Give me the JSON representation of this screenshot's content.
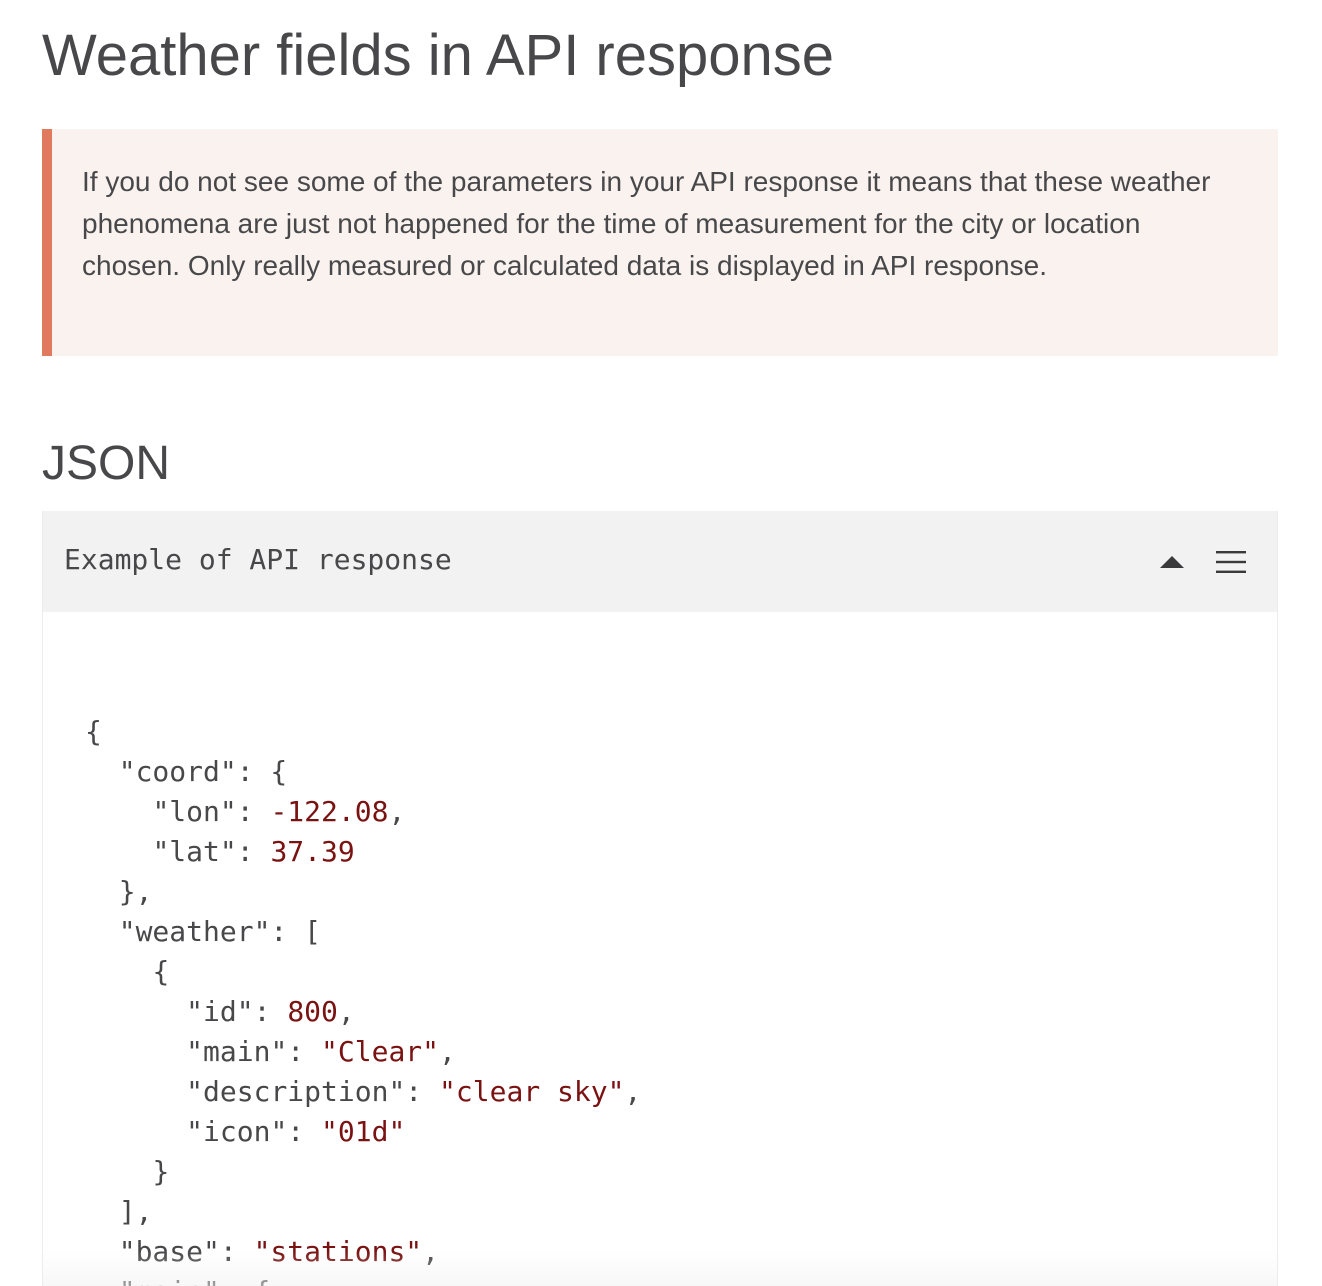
{
  "page": {
    "title": "Weather fields in API response"
  },
  "alert": {
    "text": "If you do not see some of the parameters in your API response it means that these weather phenomena are just not happened for the time of measurement for the city or location chosen. Only really measured or calculated data is displayed in API response.",
    "accent_color": "#e07a5f",
    "background_color": "#f9f2ee"
  },
  "section": {
    "title": "JSON"
  },
  "code_panel": {
    "title": "Example of API response",
    "collapse_icon": "triangle-up-icon",
    "menu_icon": "hamburger-menu-icon",
    "value_color": "#7a1212",
    "lines": [
      {
        "indent": "",
        "parts": [
          {
            "t": "p",
            "v": "{"
          }
        ]
      },
      {
        "indent": "  ",
        "parts": [
          {
            "t": "p",
            "v": "\"coord\": {"
          }
        ]
      },
      {
        "indent": "    ",
        "parts": [
          {
            "t": "p",
            "v": "\"lon\": "
          },
          {
            "t": "v",
            "v": "-122.08"
          },
          {
            "t": "p",
            "v": ","
          }
        ]
      },
      {
        "indent": "    ",
        "parts": [
          {
            "t": "p",
            "v": "\"lat\": "
          },
          {
            "t": "v",
            "v": "37.39"
          }
        ]
      },
      {
        "indent": "  ",
        "parts": [
          {
            "t": "p",
            "v": "},"
          }
        ]
      },
      {
        "indent": "  ",
        "parts": [
          {
            "t": "p",
            "v": "\"weather\": ["
          }
        ]
      },
      {
        "indent": "    ",
        "parts": [
          {
            "t": "p",
            "v": "{"
          }
        ]
      },
      {
        "indent": "      ",
        "parts": [
          {
            "t": "p",
            "v": "\"id\": "
          },
          {
            "t": "v",
            "v": "800"
          },
          {
            "t": "p",
            "v": ","
          }
        ]
      },
      {
        "indent": "      ",
        "parts": [
          {
            "t": "p",
            "v": "\"main\": "
          },
          {
            "t": "v",
            "v": "\"Clear\""
          },
          {
            "t": "p",
            "v": ","
          }
        ]
      },
      {
        "indent": "      ",
        "parts": [
          {
            "t": "p",
            "v": "\"description\": "
          },
          {
            "t": "v",
            "v": "\"clear sky\""
          },
          {
            "t": "p",
            "v": ","
          }
        ]
      },
      {
        "indent": "      ",
        "parts": [
          {
            "t": "p",
            "v": "\"icon\": "
          },
          {
            "t": "v",
            "v": "\"01d\""
          }
        ]
      },
      {
        "indent": "    ",
        "parts": [
          {
            "t": "p",
            "v": "}"
          }
        ]
      },
      {
        "indent": "  ",
        "parts": [
          {
            "t": "p",
            "v": "],"
          }
        ]
      },
      {
        "indent": "  ",
        "parts": [
          {
            "t": "p",
            "v": "\"base\": "
          },
          {
            "t": "v",
            "v": "\"stations\""
          },
          {
            "t": "p",
            "v": ","
          }
        ]
      },
      {
        "indent": "  ",
        "parts": [
          {
            "t": "p",
            "v": "\"main\": {"
          }
        ]
      }
    ]
  }
}
